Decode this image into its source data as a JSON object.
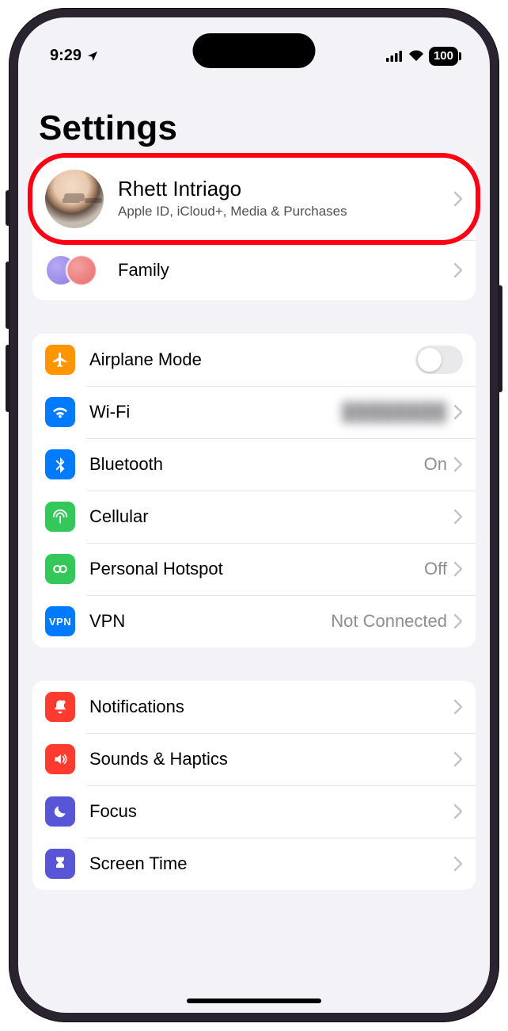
{
  "status": {
    "time": "9:29",
    "battery_text": "100"
  },
  "page": {
    "title": "Settings"
  },
  "profile": {
    "name": "Rhett Intriago",
    "subtitle": "Apple ID, iCloud+, Media & Purchases"
  },
  "family": {
    "label": "Family"
  },
  "connectivity": {
    "airplane": {
      "label": "Airplane Mode"
    },
    "wifi": {
      "label": "Wi-Fi",
      "value": "████████"
    },
    "bluetooth": {
      "label": "Bluetooth",
      "value": "On"
    },
    "cellular": {
      "label": "Cellular"
    },
    "hotspot": {
      "label": "Personal Hotspot",
      "value": "Off"
    },
    "vpn": {
      "label": "VPN",
      "value": "Not Connected",
      "icon_text": "VPN"
    }
  },
  "notifications_group": {
    "notifications": {
      "label": "Notifications"
    },
    "sounds": {
      "label": "Sounds & Haptics"
    },
    "focus": {
      "label": "Focus"
    },
    "screentime": {
      "label": "Screen Time"
    }
  }
}
